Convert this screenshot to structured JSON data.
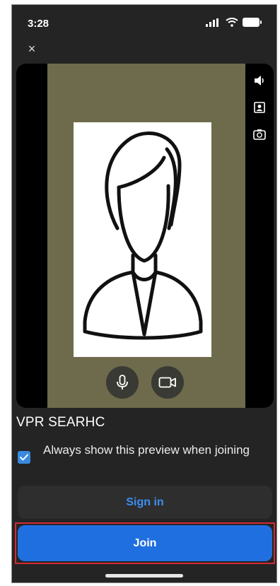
{
  "status_bar": {
    "time": "3:28"
  },
  "close_label": "×",
  "display_name": "VPR SEARHC",
  "preview_option": {
    "label": "Always show this preview when joining",
    "checked": true
  },
  "buttons": {
    "sign_in": "Sign in",
    "join": "Join"
  },
  "colors": {
    "background": "#242424",
    "video_bg": "#6e6b4c",
    "accent_blue": "#1f6fe0",
    "link_blue": "#3c8ef0",
    "highlight_red": "#d32b35"
  },
  "icons": {
    "side": [
      "speaker-icon",
      "portrait-icon",
      "camera-flip-icon"
    ],
    "controls": [
      "microphone-icon",
      "video-camera-icon"
    ]
  }
}
